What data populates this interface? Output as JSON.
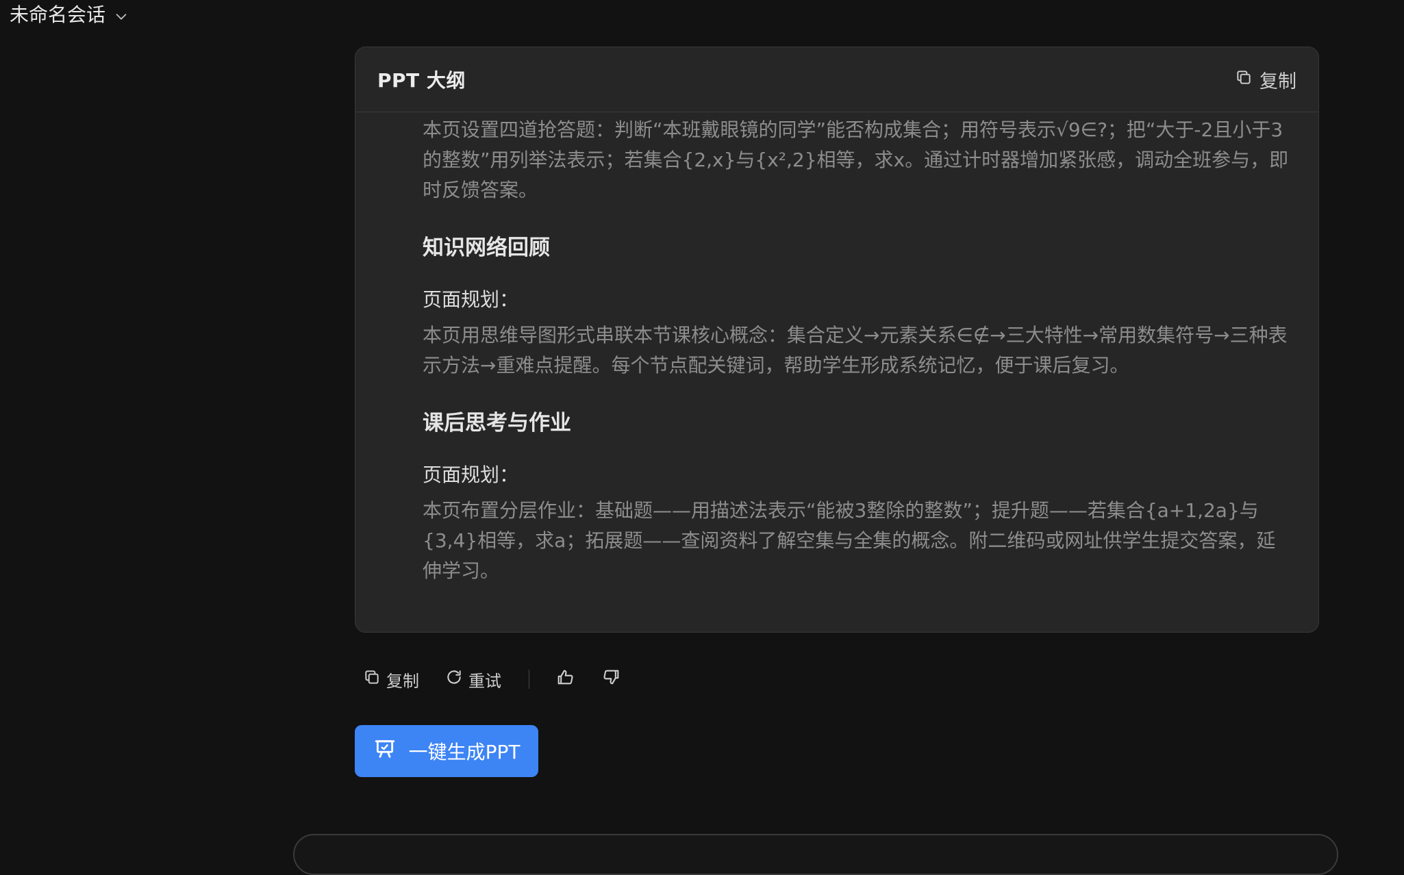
{
  "conversation": {
    "title": "未命名会话"
  },
  "outline_card": {
    "title": "PPT 大纲",
    "copy_label": "复制",
    "intro_text": "本页设置四道抢答题：判断“本班戴眼镜的同学”能否构成集合；用符号表示√9∈?；把“大于-2且小于3的整数”用列举法表示；若集合{2,x}与{x²,2}相等，求x。通过计时器增加紧张感，调动全班参与，即时反馈答案。",
    "sections": [
      {
        "title": "知识网络回顾",
        "label": "页面规划：",
        "text": "本页用思维导图形式串联本节课核心概念：集合定义→元素关系∈∉→三大特性→常用数集符号→三种表示方法→重难点提醒。每个节点配关键词，帮助学生形成系统记忆，便于课后复习。"
      },
      {
        "title": "课后思考与作业",
        "label": "页面规划：",
        "text": "本页布置分层作业：基础题——用描述法表示“能被3整除的整数”；提升题——若集合{a+1,2a}与{3,4}相等，求a；拓展题——查阅资料了解空集与全集的概念。附二维码或网址供学生提交答案，延伸学习。"
      }
    ]
  },
  "actions": {
    "copy_label": "复制",
    "retry_label": "重试",
    "like_icon": "thumbs-up-icon",
    "dislike_icon": "thumbs-down-icon"
  },
  "generate_button": {
    "label": "一键生成PPT",
    "accent_color": "#3d84f5"
  }
}
